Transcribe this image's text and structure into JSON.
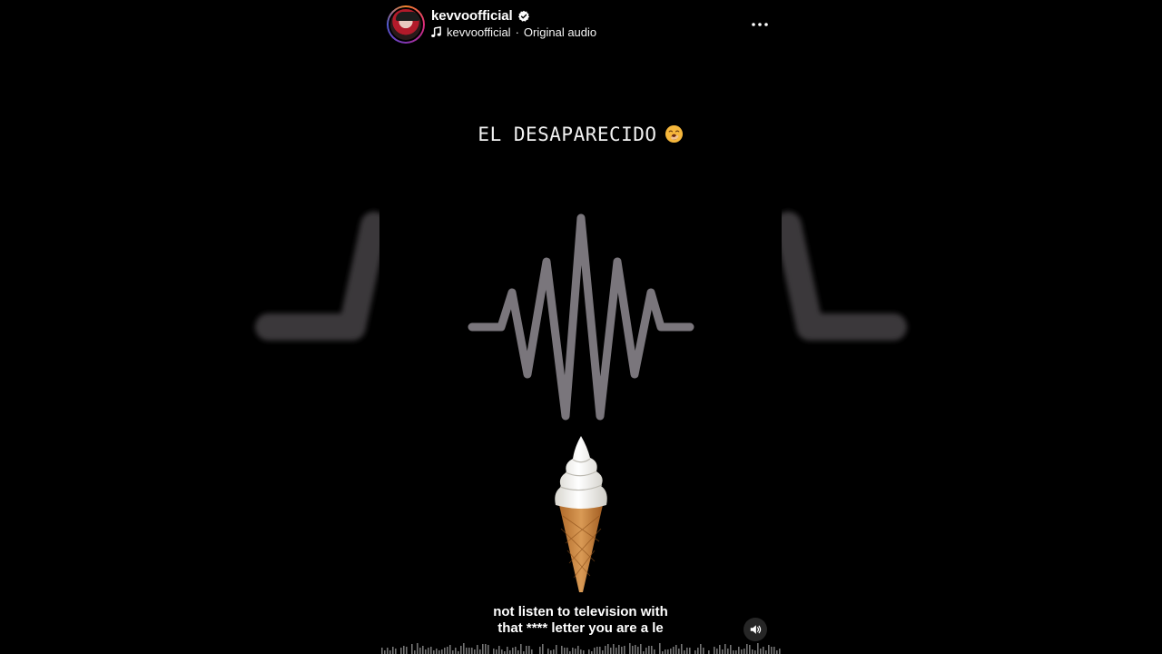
{
  "reel": {
    "username": "kevvoofficial",
    "verified": true,
    "audio_owner": "kevvoofficial",
    "audio_separator": "·",
    "audio_title": "Original audio",
    "overlay_title": "EL DESAPARECIDO",
    "overlay_emoji": "yawning-face-icon",
    "caption_line1": "not listen to television with",
    "caption_line2": "that **** letter you are a le"
  },
  "icons": {
    "more": "more-options-icon",
    "music": "music-note-icon",
    "verified": "verified-badge-icon",
    "volume": "speaker-icon"
  },
  "colors": {
    "background": "#000000",
    "waveform": "#7a767c",
    "text": "#ffffff",
    "volume_button_bg": "#262626"
  }
}
